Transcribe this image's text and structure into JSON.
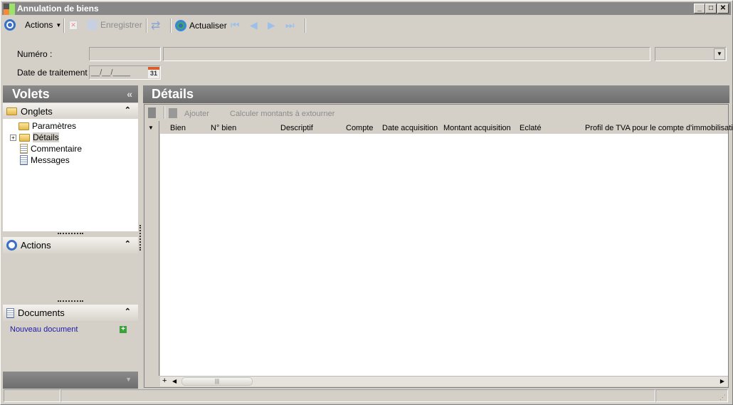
{
  "window": {
    "title": "Annulation de biens"
  },
  "toolbar": {
    "actions": "Actions",
    "save": "Enregistrer",
    "refresh": "Actualiser"
  },
  "form": {
    "numero_label": "Numéro :",
    "date_label": "Date de traitement :",
    "date_placeholder": "__/__/____",
    "calendar_day": "31"
  },
  "left_panel": {
    "title": "Volets",
    "onglets": {
      "title": "Onglets",
      "items": [
        {
          "label": "Paramètres"
        },
        {
          "label": "Détails"
        },
        {
          "label": "Commentaire"
        },
        {
          "label": "Messages"
        }
      ]
    },
    "actions": {
      "title": "Actions"
    },
    "documents": {
      "title": "Documents",
      "new_document": "Nouveau document"
    }
  },
  "details": {
    "title": "Détails",
    "toolbar": {
      "add": "Ajouter",
      "compute": "Calculer montants à extourner"
    },
    "columns": [
      "Bien",
      "N° bien",
      "Descriptif",
      "Compte",
      "Date acquisition",
      "Montant acquisition",
      "Eclaté",
      "Profil de TVA pour le compte d'immobilisati"
    ]
  }
}
